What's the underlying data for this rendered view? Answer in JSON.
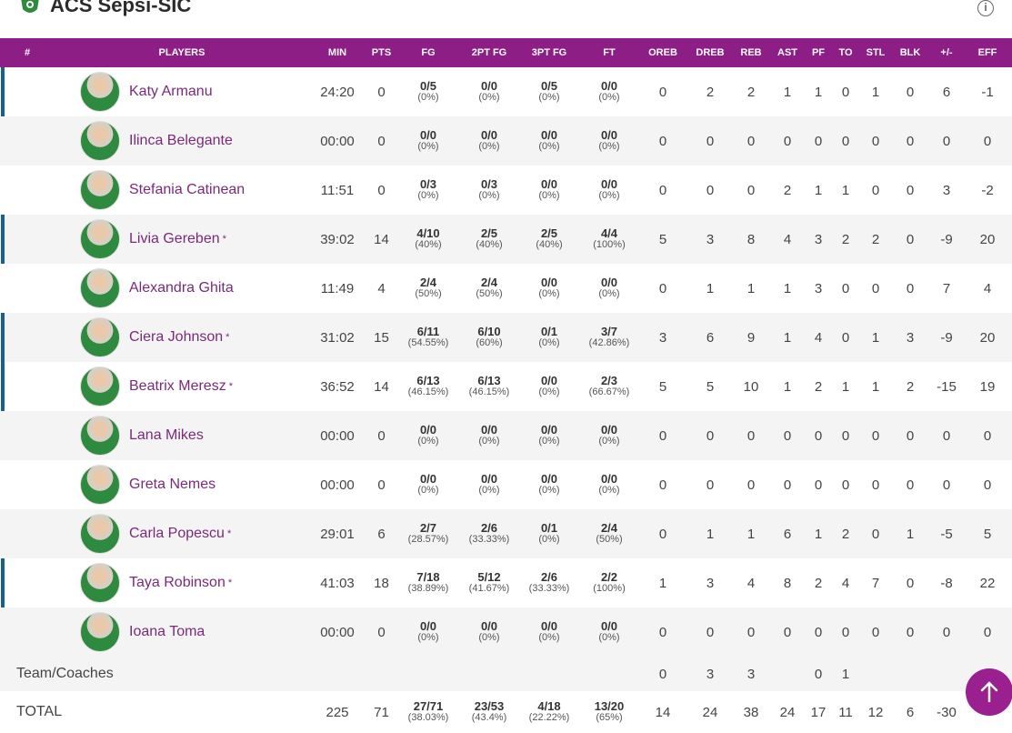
{
  "team": {
    "name": "ACS Sepsi-SIC",
    "logo_icon": "team-logo-icon",
    "info_icon": "info-icon"
  },
  "columns": [
    "#",
    "PLAYERS",
    "MIN",
    "PTS",
    "FG",
    "2PT FG",
    "3PT FG",
    "FT",
    "OREB",
    "DREB",
    "REB",
    "AST",
    "PF",
    "TO",
    "STL",
    "BLK",
    "+/-",
    "EFF"
  ],
  "players": [
    {
      "name": "Katy Armanu",
      "starter": true,
      "star": false,
      "min": "24:20",
      "pts": "0",
      "fg": "0/5",
      "fgp": "(0%)",
      "fg2": "0/0",
      "fg2p": "(0%)",
      "fg3": "0/5",
      "fg3p": "(0%)",
      "ft": "0/0",
      "ftp": "(0%)",
      "oreb": "0",
      "dreb": "2",
      "reb": "2",
      "ast": "1",
      "pf": "1",
      "to": "0",
      "stl": "1",
      "blk": "0",
      "pm": "6",
      "eff": "-1"
    },
    {
      "name": "Ilinca Belegante",
      "starter": false,
      "star": false,
      "min": "00:00",
      "pts": "0",
      "fg": "0/0",
      "fgp": "(0%)",
      "fg2": "0/0",
      "fg2p": "(0%)",
      "fg3": "0/0",
      "fg3p": "(0%)",
      "ft": "0/0",
      "ftp": "(0%)",
      "oreb": "0",
      "dreb": "0",
      "reb": "0",
      "ast": "0",
      "pf": "0",
      "to": "0",
      "stl": "0",
      "blk": "0",
      "pm": "0",
      "eff": "0"
    },
    {
      "name": "Stefania Catinean",
      "starter": false,
      "star": false,
      "min": "11:51",
      "pts": "0",
      "fg": "0/3",
      "fgp": "(0%)",
      "fg2": "0/3",
      "fg2p": "(0%)",
      "fg3": "0/0",
      "fg3p": "(0%)",
      "ft": "0/0",
      "ftp": "(0%)",
      "oreb": "0",
      "dreb": "0",
      "reb": "0",
      "ast": "2",
      "pf": "1",
      "to": "1",
      "stl": "0",
      "blk": "0",
      "pm": "3",
      "eff": "-2"
    },
    {
      "name": "Livia Gereben",
      "starter": true,
      "star": true,
      "min": "39:02",
      "pts": "14",
      "fg": "4/10",
      "fgp": "(40%)",
      "fg2": "2/5",
      "fg2p": "(40%)",
      "fg3": "2/5",
      "fg3p": "(40%)",
      "ft": "4/4",
      "ftp": "(100%)",
      "oreb": "5",
      "dreb": "3",
      "reb": "8",
      "ast": "4",
      "pf": "3",
      "to": "2",
      "stl": "2",
      "blk": "0",
      "pm": "-9",
      "eff": "20"
    },
    {
      "name": "Alexandra Ghita",
      "starter": false,
      "star": false,
      "min": "11:49",
      "pts": "4",
      "fg": "2/4",
      "fgp": "(50%)",
      "fg2": "2/4",
      "fg2p": "(50%)",
      "fg3": "0/0",
      "fg3p": "(0%)",
      "ft": "0/0",
      "ftp": "(0%)",
      "oreb": "0",
      "dreb": "1",
      "reb": "1",
      "ast": "1",
      "pf": "3",
      "to": "0",
      "stl": "0",
      "blk": "0",
      "pm": "7",
      "eff": "4"
    },
    {
      "name": "Ciera Johnson",
      "starter": true,
      "star": true,
      "min": "31:02",
      "pts": "15",
      "fg": "6/11",
      "fgp": "(54.55%)",
      "fg2": "6/10",
      "fg2p": "(60%)",
      "fg3": "0/1",
      "fg3p": "(0%)",
      "ft": "3/7",
      "ftp": "(42.86%)",
      "oreb": "3",
      "dreb": "6",
      "reb": "9",
      "ast": "1",
      "pf": "4",
      "to": "0",
      "stl": "1",
      "blk": "3",
      "pm": "-9",
      "eff": "20"
    },
    {
      "name": "Beatrix Meresz",
      "starter": true,
      "star": true,
      "min": "36:52",
      "pts": "14",
      "fg": "6/13",
      "fgp": "(46.15%)",
      "fg2": "6/13",
      "fg2p": "(46.15%)",
      "fg3": "0/0",
      "fg3p": "(0%)",
      "ft": "2/3",
      "ftp": "(66.67%)",
      "oreb": "5",
      "dreb": "5",
      "reb": "10",
      "ast": "1",
      "pf": "2",
      "to": "1",
      "stl": "1",
      "blk": "2",
      "pm": "-15",
      "eff": "19"
    },
    {
      "name": "Lana Mikes",
      "starter": false,
      "star": false,
      "min": "00:00",
      "pts": "0",
      "fg": "0/0",
      "fgp": "(0%)",
      "fg2": "0/0",
      "fg2p": "(0%)",
      "fg3": "0/0",
      "fg3p": "(0%)",
      "ft": "0/0",
      "ftp": "(0%)",
      "oreb": "0",
      "dreb": "0",
      "reb": "0",
      "ast": "0",
      "pf": "0",
      "to": "0",
      "stl": "0",
      "blk": "0",
      "pm": "0",
      "eff": "0"
    },
    {
      "name": "Greta Nemes",
      "starter": false,
      "star": false,
      "min": "00:00",
      "pts": "0",
      "fg": "0/0",
      "fgp": "(0%)",
      "fg2": "0/0",
      "fg2p": "(0%)",
      "fg3": "0/0",
      "fg3p": "(0%)",
      "ft": "0/0",
      "ftp": "(0%)",
      "oreb": "0",
      "dreb": "0",
      "reb": "0",
      "ast": "0",
      "pf": "0",
      "to": "0",
      "stl": "0",
      "blk": "0",
      "pm": "0",
      "eff": "0"
    },
    {
      "name": "Carla Popescu",
      "starter": false,
      "star": true,
      "min": "29:01",
      "pts": "6",
      "fg": "2/7",
      "fgp": "(28.57%)",
      "fg2": "2/6",
      "fg2p": "(33.33%)",
      "fg3": "0/1",
      "fg3p": "(0%)",
      "ft": "2/4",
      "ftp": "(50%)",
      "oreb": "0",
      "dreb": "1",
      "reb": "1",
      "ast": "6",
      "pf": "1",
      "to": "2",
      "stl": "0",
      "blk": "1",
      "pm": "-5",
      "eff": "5"
    },
    {
      "name": "Taya Robinson",
      "starter": true,
      "star": true,
      "min": "41:03",
      "pts": "18",
      "fg": "7/18",
      "fgp": "(38.89%)",
      "fg2": "5/12",
      "fg2p": "(41.67%)",
      "fg3": "2/6",
      "fg3p": "(33.33%)",
      "ft": "2/2",
      "ftp": "(100%)",
      "oreb": "1",
      "dreb": "3",
      "reb": "4",
      "ast": "8",
      "pf": "2",
      "to": "4",
      "stl": "7",
      "blk": "0",
      "pm": "-8",
      "eff": "22"
    },
    {
      "name": "Ioana Toma",
      "starter": false,
      "star": false,
      "min": "00:00",
      "pts": "0",
      "fg": "0/0",
      "fgp": "(0%)",
      "fg2": "0/0",
      "fg2p": "(0%)",
      "fg3": "0/0",
      "fg3p": "(0%)",
      "ft": "0/0",
      "ftp": "(0%)",
      "oreb": "0",
      "dreb": "0",
      "reb": "0",
      "ast": "0",
      "pf": "0",
      "to": "0",
      "stl": "0",
      "blk": "0",
      "pm": "0",
      "eff": "0"
    }
  ],
  "team_coaches": {
    "label": "Team/Coaches",
    "oreb": "0",
    "dreb": "3",
    "reb": "3",
    "pf": "0",
    "to": "1"
  },
  "total": {
    "label": "TOTAL",
    "min": "225",
    "pts": "71",
    "fg": "27/71",
    "fgp": "(38.03%)",
    "fg2": "23/53",
    "fg2p": "(43.4%)",
    "fg3": "4/18",
    "fg3p": "(22.22%)",
    "ft": "13/20",
    "ftp": "(65%)",
    "oreb": "14",
    "dreb": "24",
    "reb": "38",
    "ast": "24",
    "pf": "17",
    "to": "11",
    "stl": "12",
    "blk": "6",
    "pm": "-30"
  },
  "star_symbol": "*",
  "scroll_top_icon": "arrow-up-icon",
  "colors": {
    "header_bg": "#8d1e85",
    "player_name": "#7a2a7a",
    "starter_bar": "#1c5f8f",
    "scroll_button": "#9a1f8f"
  }
}
